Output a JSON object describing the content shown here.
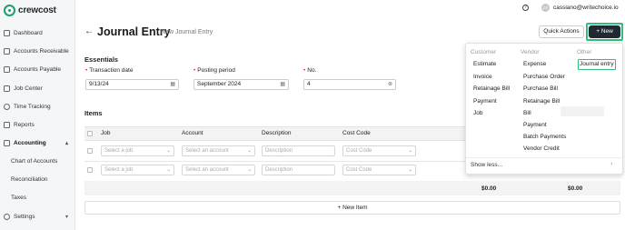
{
  "brand": {
    "name": "crewcost"
  },
  "sidebar": {
    "items": [
      {
        "label": "Dashboard"
      },
      {
        "label": "Accounts Receivable"
      },
      {
        "label": "Accounts Payable"
      },
      {
        "label": "Job Center"
      },
      {
        "label": "Time Tracking"
      },
      {
        "label": "Reports"
      },
      {
        "label": "Accounting"
      },
      {
        "label": "Settings"
      }
    ],
    "sub_items": [
      {
        "label": "Chart of Accounts"
      },
      {
        "label": "Reconciliation"
      },
      {
        "label": "Taxes"
      }
    ]
  },
  "topbar": {
    "avatar_initials": "CE",
    "email": "cassiano@writechoice.io"
  },
  "header": {
    "title": "Journal Entry",
    "subtitle": "New Journal Entry",
    "quick_actions_label": "Quick Actions",
    "new_label": "+ New"
  },
  "essentials": {
    "section_label": "Essentials",
    "transaction_date": {
      "label": "Transaction date",
      "value": "9/13/24"
    },
    "posting_period": {
      "label": "Posting period",
      "value": "September 2024"
    },
    "number": {
      "label": "No.",
      "value": "4"
    }
  },
  "items": {
    "section_label": "Items",
    "columns": [
      "Job",
      "Account",
      "Description",
      "Cost Code"
    ],
    "placeholders": {
      "job": "Select a job",
      "account": "Select an account",
      "description": "Description",
      "cost_code": "Cost Code"
    },
    "totals": [
      "$0.00",
      "$0.00"
    ],
    "new_item_label": "+ New Item"
  },
  "new_menu": {
    "columns": [
      {
        "header": "Customer",
        "items": [
          "Estimate",
          "Invoice",
          "Retainage Bill",
          "Payment",
          "Job"
        ]
      },
      {
        "header": "Vendor",
        "items": [
          "Expense",
          "Purchase Order",
          "Purchase Bill",
          "Retainage Bill",
          "Bill",
          "Payment",
          "Batch Payments",
          "Vendor Credit"
        ]
      },
      {
        "header": "Other",
        "items": [
          "Journal entry"
        ]
      }
    ],
    "show_less_label": "Show less..."
  },
  "colors": {
    "accent": "#2fbf7a",
    "primary_button": "#202a33",
    "required": "#d33333"
  }
}
